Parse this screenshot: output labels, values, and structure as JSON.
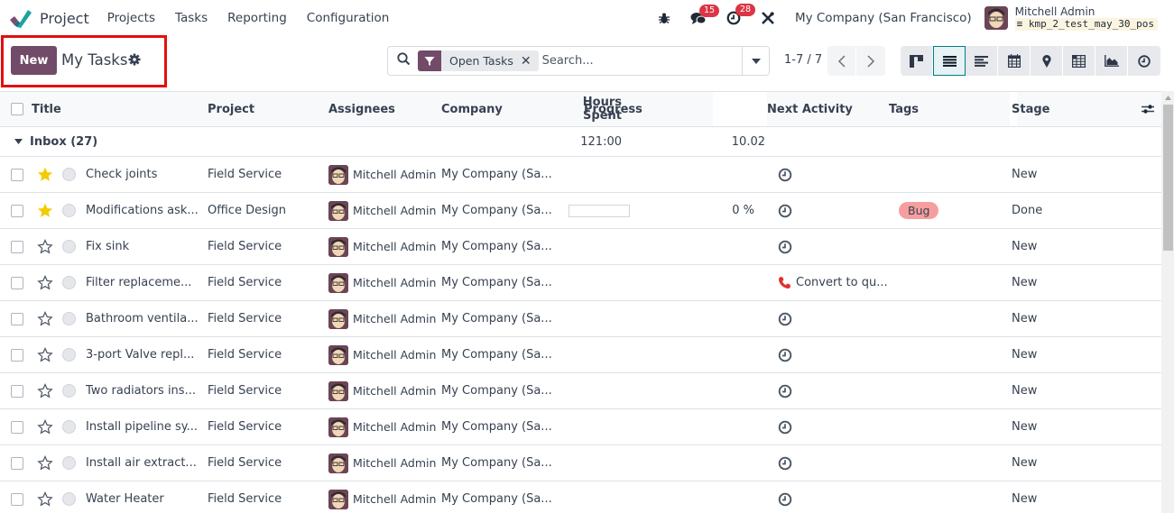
{
  "navbar": {
    "app_name": "Project",
    "menu": [
      "Projects",
      "Tasks",
      "Reporting",
      "Configuration"
    ],
    "messages_count": "15",
    "activities_count": "28",
    "company": "My Company (San Francisco)",
    "user_name": "Mitchell Admin",
    "database": "kmp_2_test_may_30_pos"
  },
  "control_panel": {
    "new_label": "New",
    "title": "My Tasks",
    "search": {
      "facet_label": "Open Tasks",
      "placeholder": "Search..."
    },
    "pager": "1-7 / 7",
    "views": [
      "kanban",
      "list",
      "gantt",
      "calendar",
      "map",
      "pivot",
      "graph",
      "activity"
    ],
    "active_view": "list"
  },
  "table": {
    "columns": [
      "Title",
      "Project",
      "Assignees",
      "Company",
      "Hours Spent",
      "Progress",
      "Next Activity",
      "Tags",
      "Stage"
    ],
    "group": {
      "label": "Inbox (27)",
      "hours_spent": "121:00",
      "progress": "10.02"
    },
    "rows": [
      {
        "starred": true,
        "title": "Check joints",
        "project": "Field Service",
        "assignee": "Mitchell Admin",
        "company": "My Company (Sa...",
        "progress": "",
        "activity": "",
        "activity_type": "clock",
        "tag": "",
        "stage": "New"
      },
      {
        "starred": true,
        "title": "Modifications ask...",
        "project": "Office Design",
        "assignee": "Mitchell Admin",
        "company": "My Company (Sa...",
        "progress": "0 %",
        "progress_value": 0,
        "activity": "",
        "activity_type": "clock",
        "tag": "Bug",
        "stage": "Done"
      },
      {
        "starred": false,
        "title": "Fix sink",
        "project": "Field Service",
        "assignee": "Mitchell Admin",
        "company": "My Company (Sa...",
        "progress": "",
        "activity": "",
        "activity_type": "clock",
        "tag": "",
        "stage": "New"
      },
      {
        "starred": false,
        "title": "Filter replaceme...",
        "project": "Field Service",
        "assignee": "Mitchell Admin",
        "company": "My Company (Sa...",
        "progress": "",
        "activity": "Convert to qu...",
        "activity_type": "phone",
        "tag": "",
        "stage": "New"
      },
      {
        "starred": false,
        "title": "Bathroom ventila...",
        "project": "Field Service",
        "assignee": "Mitchell Admin",
        "company": "My Company (Sa...",
        "progress": "",
        "activity": "",
        "activity_type": "clock",
        "tag": "",
        "stage": "New"
      },
      {
        "starred": false,
        "title": "3-port Valve repl...",
        "project": "Field Service",
        "assignee": "Mitchell Admin",
        "company": "My Company (Sa...",
        "progress": "",
        "activity": "",
        "activity_type": "clock",
        "tag": "",
        "stage": "New"
      },
      {
        "starred": false,
        "title": "Two radiators ins...",
        "project": "Field Service",
        "assignee": "Mitchell Admin",
        "company": "My Company (Sa...",
        "progress": "",
        "activity": "",
        "activity_type": "clock",
        "tag": "",
        "stage": "New"
      },
      {
        "starred": false,
        "title": "Install pipeline sy...",
        "project": "Field Service",
        "assignee": "Mitchell Admin",
        "company": "My Company (Sa...",
        "progress": "",
        "activity": "",
        "activity_type": "clock",
        "tag": "",
        "stage": "New"
      },
      {
        "starred": false,
        "title": "Install air extract...",
        "project": "Field Service",
        "assignee": "Mitchell Admin",
        "company": "My Company (Sa...",
        "progress": "",
        "activity": "",
        "activity_type": "clock",
        "tag": "",
        "stage": "New"
      },
      {
        "starred": false,
        "title": "Water Heater",
        "project": "Field Service",
        "assignee": "Mitchell Admin",
        "company": "My Company (Sa...",
        "progress": "",
        "activity": "",
        "activity_type": "clock",
        "tag": "",
        "stage": "New"
      }
    ]
  },
  "colors": {
    "brand": "#714b67",
    "active_view_border": "#017e84",
    "badge": "#dc3545",
    "star": "#f3cc00",
    "tag_bug": "#f69e9e",
    "phone": "#e0322b",
    "highlight": "#e20f0f"
  }
}
